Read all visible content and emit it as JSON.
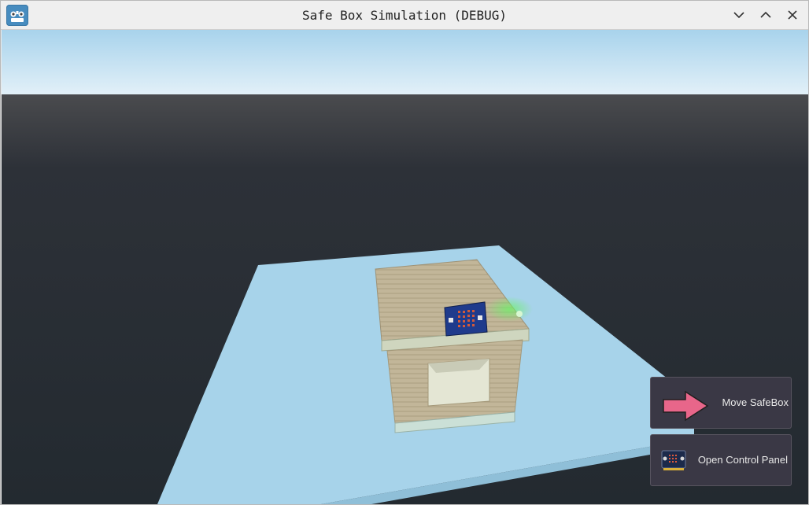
{
  "window": {
    "title": "Safe Box Simulation (DEBUG)",
    "app_icon": "godot-icon",
    "controls": [
      "minimize-icon",
      "maximize-icon",
      "close-icon"
    ]
  },
  "scene": {
    "description_icon": "microbit-board"
  },
  "buttons": {
    "move_safebox": {
      "label": "Move SafeBox",
      "icon": "right-arrow-icon"
    },
    "open_control_panel": {
      "label": "Open Control Panel",
      "icon": "microbit-icon"
    }
  },
  "colors": {
    "sky_top": "#a8d3ec",
    "sky_bottom": "#e2f0f8",
    "ground": "#262c33",
    "platform": "#a7d3ea",
    "box": "#c4b89b",
    "button_bg": "#3a3845",
    "arrow": "#e8668a"
  }
}
